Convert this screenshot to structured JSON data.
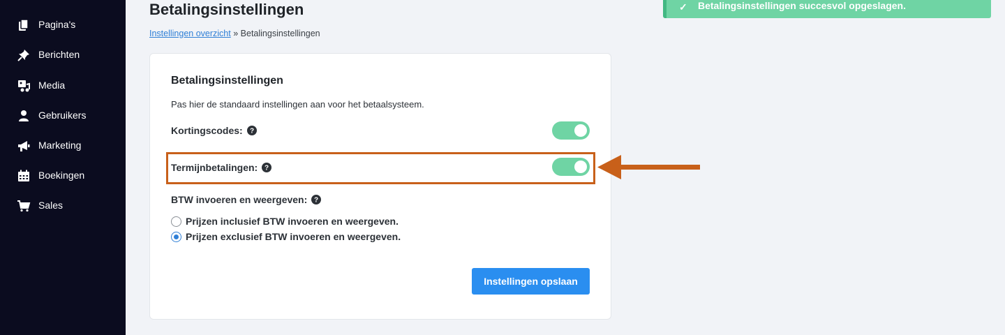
{
  "sidebar": {
    "items": [
      {
        "label": "Pagina's",
        "icon": "pages-icon"
      },
      {
        "label": "Berichten",
        "icon": "pin-icon"
      },
      {
        "label": "Media",
        "icon": "media-icon"
      },
      {
        "label": "Gebruikers",
        "icon": "user-icon"
      },
      {
        "label": "Marketing",
        "icon": "megaphone-icon"
      },
      {
        "label": "Boekingen",
        "icon": "calendar-icon"
      },
      {
        "label": "Sales",
        "icon": "cart-icon"
      }
    ]
  },
  "header": {
    "title": "Betalingsinstellingen",
    "breadcrumb": {
      "link_label": "Instellingen overzicht",
      "separator": "»",
      "current": "Betalingsinstellingen"
    }
  },
  "toast": {
    "message": "Betalingsinstellingen succesvol opgeslagen.",
    "icon": "check-icon"
  },
  "card": {
    "title": "Betalingsinstellingen",
    "description": "Pas hier de standaard instellingen aan voor het betaalsysteem.",
    "settings": {
      "discount_codes": {
        "label": "Kortingscodes:",
        "enabled": true
      },
      "installments": {
        "label": "Termijnbetalingen:",
        "enabled": true
      }
    },
    "vat": {
      "label": "BTW invoeren en weergeven:",
      "options": [
        {
          "label": "Prijzen inclusief BTW invoeren en weergeven.",
          "checked": false
        },
        {
          "label": "Prijzen exclusief BTW invoeren en weergeven.",
          "checked": true
        }
      ]
    },
    "save_label": "Instellingen opslaan"
  },
  "colors": {
    "sidebar_bg": "#0b0c1f",
    "toggle_on": "#6fd4a4",
    "primary": "#2a8ef0",
    "annotation": "#c8601a"
  }
}
